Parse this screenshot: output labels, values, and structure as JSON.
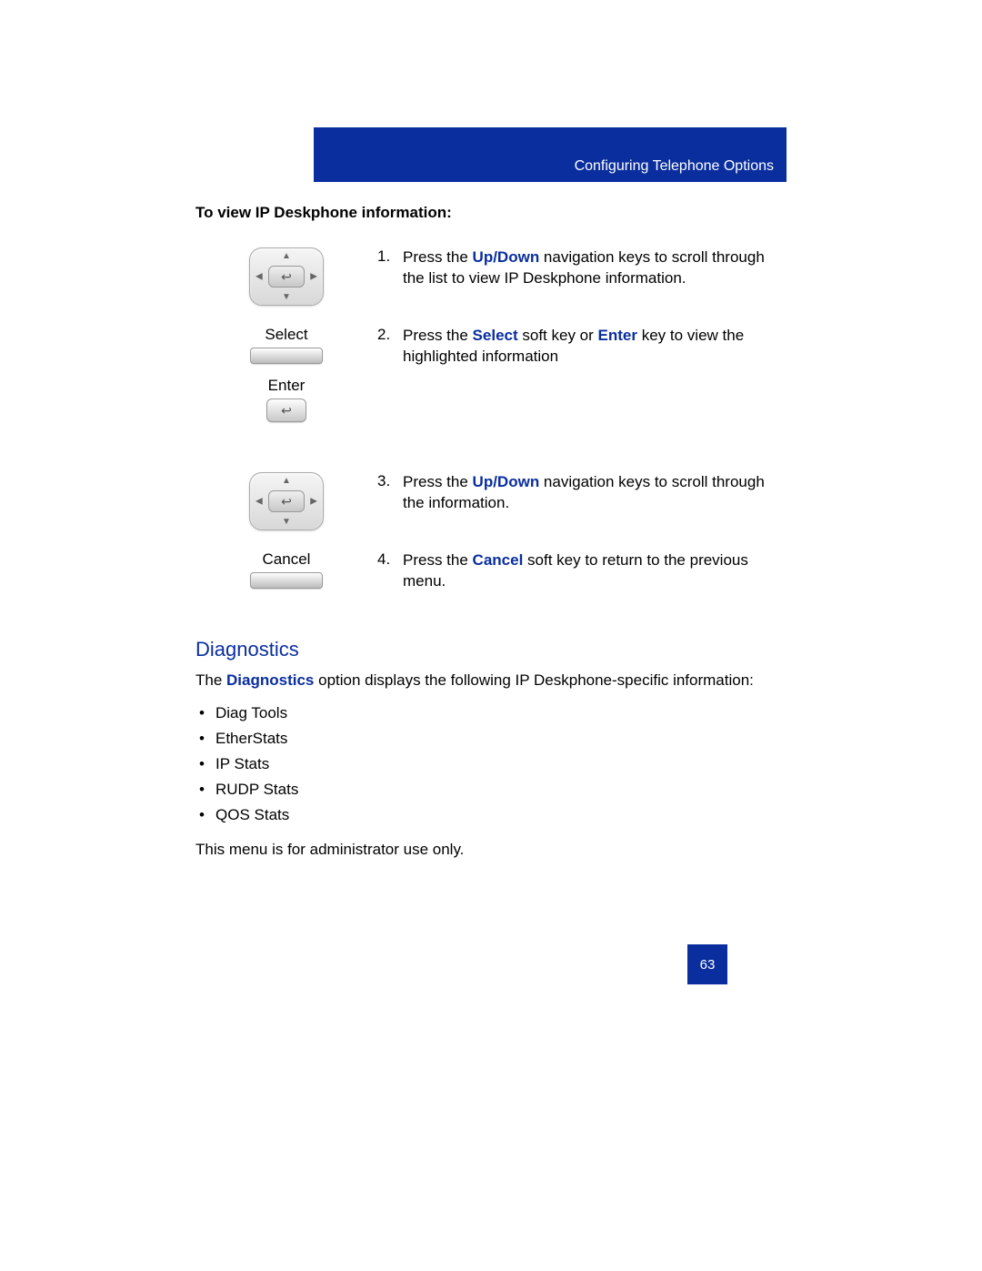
{
  "header": {
    "section": "Configuring Telephone Options"
  },
  "section_title": "To view IP Deskphone information:",
  "steps": {
    "s1": {
      "num": "1.",
      "pre": "Press the ",
      "hl1": "Up/Down",
      "post": " navigation keys to scroll through the list to view IP Deskphone information."
    },
    "s2": {
      "select_label": "Select",
      "enter_label": "Enter",
      "num": "2.",
      "t1": " Press the ",
      "hl_select": "Select",
      "t2": " soft key or ",
      "hl_enter": "Enter",
      "t3": " key to view the highlighted information"
    },
    "s3": {
      "num": "3.",
      "pre": "Press the ",
      "hl1": "Up/Down",
      "post": " navigation keys to scroll through the information."
    },
    "s4": {
      "cancel_label": "Cancel",
      "num": "4.",
      "pre": "Press the ",
      "hl1": "Cancel",
      "post": " soft key to return to the previous menu."
    }
  },
  "diagnostics": {
    "heading": "Diagnostics",
    "intro_pre": "The ",
    "intro_hl": "Diagnostics",
    "intro_post": " option displays the following IP Deskphone-specific information:",
    "items": {
      "i1": "Diag Tools",
      "i2": "EtherStats",
      "i3": "IP Stats",
      "i4": "RUDP Stats",
      "i5": "QOS Stats"
    },
    "note": "This menu is for administrator use only."
  },
  "page_number": "63"
}
